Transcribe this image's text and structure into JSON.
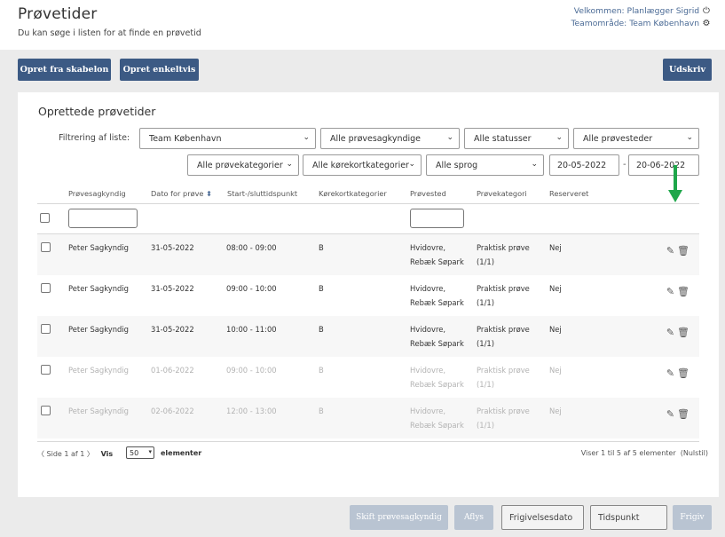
{
  "header": {
    "title": "Prøvetider",
    "subtitle": "Du kan søge i listen for at finde en prøvetid",
    "welcome": "Velkommen: Planlægger Sigrid",
    "team_area": "Teamområde: Team København",
    "power_icon": "power-icon",
    "gear_icon": "gear-icon"
  },
  "toolbar": {
    "create_from_template": "Opret fra skabelon",
    "create_single": "Opret enkeltvis",
    "print": "Udskriv"
  },
  "panel": {
    "title": "Oprettede prøvetider",
    "filter_label": "Filtrering af liste:",
    "filters": {
      "team": "Team København",
      "examiner": "Alle prøvesagkyndige",
      "status": "Alle statusser",
      "location": "Alle prøvesteder",
      "category": "Alle prøvekategorier",
      "license_category": "Alle kørekortkategorier",
      "language": "Alle sprog",
      "date_from": "20-05-2022",
      "date_to": "20-06-2022",
      "date_separator": "-"
    },
    "columns": {
      "examiner": "Prøvesagkyndig",
      "date": "Dato for prøve",
      "time": "Start-/sluttidspunkt",
      "license_category": "Kørekortkategorier",
      "location": "Prøvested",
      "category": "Prøvekategori",
      "reserved": "Reserveret"
    },
    "rows": [
      {
        "examiner": "Peter Sagkyndig",
        "date": "31-05-2022",
        "time": "08:00 - 09:00",
        "license": "B",
        "location1": "Hvidovre,",
        "location2": "Rebæk Søpark",
        "category1": "Praktisk prøve",
        "category2": "(1/1)",
        "reserved": "Nej"
      },
      {
        "examiner": "Peter Sagkyndig",
        "date": "31-05-2022",
        "time": "09:00 - 10:00",
        "license": "B",
        "location1": "Hvidovre,",
        "location2": "Rebæk Søpark",
        "category1": "Praktisk prøve",
        "category2": "(1/1)",
        "reserved": "Nej"
      },
      {
        "examiner": "Peter Sagkyndig",
        "date": "31-05-2022",
        "time": "10:00 - 11:00",
        "license": "B",
        "location1": "Hvidovre,",
        "location2": "Rebæk Søpark",
        "category1": "Praktisk prøve",
        "category2": "(1/1)",
        "reserved": "Nej"
      },
      {
        "examiner": "Peter Sagkyndig",
        "date": "01-06-2022",
        "time": "09:00 - 10:00",
        "license": "B",
        "location1": "Hvidovre,",
        "location2": "Rebæk Søpark",
        "category1": "Praktisk prøve",
        "category2": "(1/1)",
        "reserved": "Nej"
      },
      {
        "examiner": "Peter Sagkyndig",
        "date": "02-06-2022",
        "time": "12:00 - 13:00",
        "license": "B",
        "location1": "Hvidovre,",
        "location2": "Rebæk Søpark",
        "category1": "Praktisk prøve",
        "category2": "(1/1)",
        "reserved": "Nej"
      }
    ],
    "pager": {
      "page_text": "Side 1 af 1",
      "show_label": "Vis",
      "page_size": "50",
      "elements_label": "elementer",
      "summary": "Viser 1 til 5 af 5 elementer",
      "reset": "(Nulstil)"
    }
  },
  "footer": {
    "change_examiner": "Skift prøvesagkyndig",
    "cancel": "Aflys",
    "release_date_placeholder": "Frigivelsesdato",
    "time_placeholder": "Tidspunkt",
    "release": "Frigiv"
  },
  "colors": {
    "primary": "#3c5a84",
    "disabled": "#b9c4d2",
    "annotation_arrow": "#1ea64a"
  }
}
